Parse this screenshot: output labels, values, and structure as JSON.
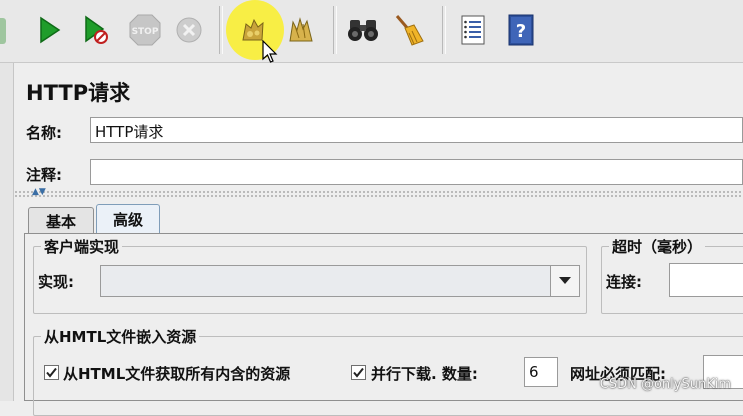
{
  "toolbar": {
    "buttons": [
      {
        "name": "start",
        "icon": "play-icon",
        "color": "#1f9d2a"
      },
      {
        "name": "start-no-pauses",
        "icon": "play-no-pause-icon",
        "color": "#1f9d2a"
      },
      {
        "name": "stop",
        "icon": "stop-icon",
        "color": "#bdbdbd",
        "label": "STOP"
      },
      {
        "name": "shutdown",
        "icon": "shutdown-icon",
        "color": "#c4c4c4"
      },
      {
        "name": "clear",
        "icon": "clear-icon",
        "color": "#c9a43a"
      },
      {
        "name": "clear-all",
        "icon": "clear-all-icon",
        "color": "#c9a43a"
      },
      {
        "name": "search",
        "icon": "binoculars-icon",
        "color": "#222"
      },
      {
        "name": "reset-search",
        "icon": "broom-icon",
        "color": "#e0a020"
      },
      {
        "name": "function-helper",
        "icon": "list-icon",
        "color": "#3a5fa8"
      },
      {
        "name": "help",
        "icon": "help-icon",
        "color": "#2d4f9a",
        "label": "?"
      }
    ]
  },
  "panel": {
    "title": "HTTP请求",
    "name_label": "名称:",
    "name_value": "HTTP请求",
    "comment_label": "注释:",
    "comment_value": ""
  },
  "tabs": [
    {
      "label": "基本",
      "active": false
    },
    {
      "label": "高级",
      "active": true
    }
  ],
  "advanced": {
    "client_group_title": "客户端实现",
    "impl_label": "实现:",
    "impl_value": "",
    "timeout_group_title": "超时（毫秒）",
    "connect_label": "连接:",
    "connect_value": "",
    "embedded_group_title": "从HMTL文件嵌入资源",
    "retrieve_all_label": "从HTML文件获取所有内含的资源",
    "retrieve_all_checked": true,
    "parallel_label": "并行下载. 数量:",
    "parallel_checked": true,
    "parallel_count": "6",
    "url_match_label": "网址必须匹配:",
    "url_match_value": ""
  },
  "watermark": "CSDN @onlySunKim",
  "colors": {
    "highlight": "#faee28",
    "tab_active": "#ebf1f8"
  }
}
